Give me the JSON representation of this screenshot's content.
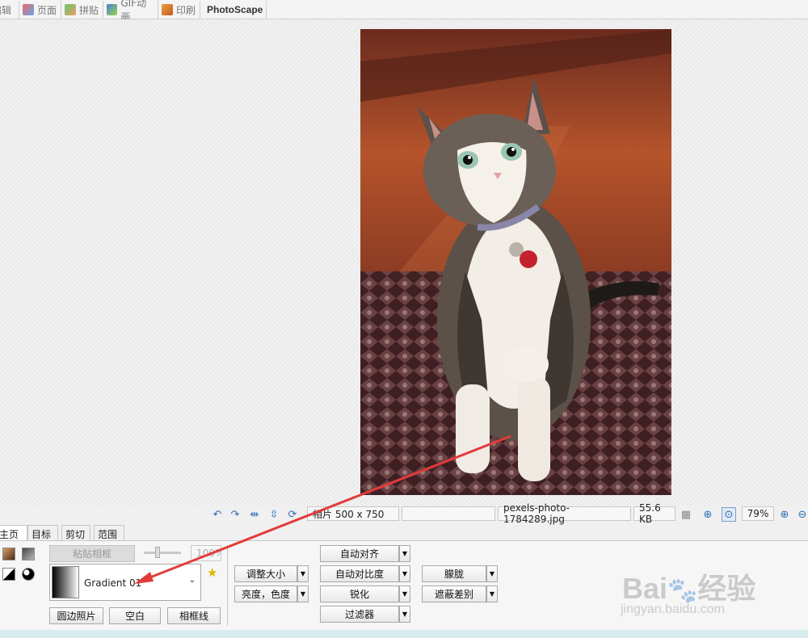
{
  "top_tabs": [
    {
      "label": "编辑",
      "icon": "edit-icon"
    },
    {
      "label": "页面",
      "icon": "page-icon"
    },
    {
      "label": "拼贴",
      "icon": "collage-icon"
    },
    {
      "label": "GIF动画",
      "icon": "gif-icon"
    },
    {
      "label": "印刷",
      "icon": "print-icon"
    },
    {
      "label": "PhotoScape",
      "icon": "photoscape-icon"
    }
  ],
  "status": {
    "photo_size": "相片 500 x 750",
    "blank_field": "",
    "filename": "pexels-photo-1784289.jpg",
    "filesize": "55.6 KB",
    "zoom": "79%"
  },
  "bottom_tabs": [
    "主页",
    "目标",
    "剪切",
    "范围"
  ],
  "panel": {
    "paste_frame": "粘贴相框",
    "opacity_value": "100%",
    "frame_name": "Gradient 01",
    "round_photo": "圆边照片",
    "blank": "空白",
    "frame_line": "相框线",
    "resize": "调整大小",
    "brightness": "亮度，色度",
    "auto_level": "自动对齐",
    "auto_contrast": "自动对比度",
    "sharpen": "锐化",
    "filter": "过滤器",
    "bloom": "朦胧",
    "vignette": "遮蔽差别"
  },
  "watermark": {
    "brand": "Bai",
    "brand2": "经验",
    "url": "jingyan.baidu.com"
  },
  "colors": {
    "arrow": "#e23b3b",
    "accent": "#2d6fb3"
  }
}
